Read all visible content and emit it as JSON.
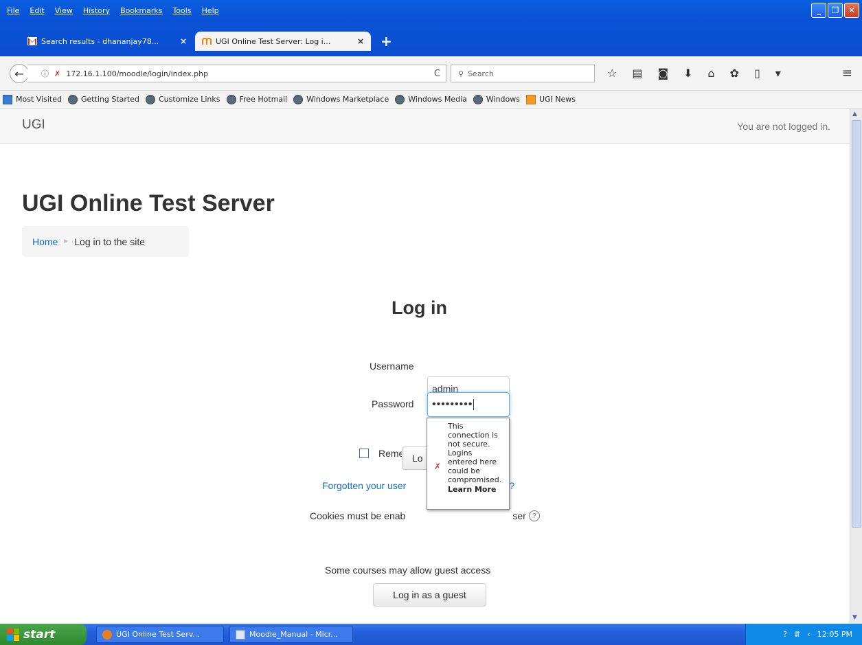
{
  "menubar": [
    "File",
    "Edit",
    "View",
    "History",
    "Bookmarks",
    "Tools",
    "Help"
  ],
  "tabs": [
    {
      "title": "Search results - dhananjay78...",
      "close": "×"
    },
    {
      "title": "UGI Online Test Server: Log i...",
      "close": "×"
    }
  ],
  "newtab": "+",
  "navigation": {
    "back": "←",
    "url": "172.16.1.100/moodle/login/index.php",
    "reload": "C",
    "search_placeholder": "Search"
  },
  "bookmarks": [
    {
      "label": "Most Visited",
      "icon": "square"
    },
    {
      "label": "Getting Started",
      "icon": "globe"
    },
    {
      "label": "Customize Links",
      "icon": "globe"
    },
    {
      "label": "Free Hotmail",
      "icon": "globe"
    },
    {
      "label": "Windows Marketplace",
      "icon": "globe"
    },
    {
      "label": "Windows Media",
      "icon": "globe"
    },
    {
      "label": "Windows",
      "icon": "globe"
    },
    {
      "label": "UGI News",
      "icon": "rss"
    }
  ],
  "site": {
    "brand": "UGI",
    "login_status": "You are not logged in.",
    "heading": "UGI Online Test Server",
    "breadcrumb": {
      "home": "Home",
      "current": "Log in to the site"
    }
  },
  "login": {
    "title": "Log in",
    "username_label": "Username",
    "username_value": "admin",
    "password_label": "Password",
    "password_mask": "•••••••••",
    "remember_label": "Rememb",
    "login_button_partial": "Lo",
    "forgot_link": "Forgotten your user",
    "forgot_link_tail": "ord?",
    "cookies_text": "Cookies must be enab",
    "cookies_tail": "ser",
    "guest_text": "Some courses may allow guest access",
    "guest_button": "Log in as a guest"
  },
  "tooltip": {
    "lines": [
      "This",
      "connection is",
      "not secure.",
      "Logins",
      "entered here",
      "could be",
      "compromised."
    ],
    "learn_more": "Learn More"
  },
  "taskbar": {
    "start": "start",
    "items": [
      "UGI Online Test Serv...",
      "Moodle_Manual - Micr..."
    ],
    "clock": "12:05 PM"
  },
  "colors": {
    "link": "#0f6fc5",
    "titlebar": "#0b4ed0",
    "focus": "#66afe9"
  }
}
